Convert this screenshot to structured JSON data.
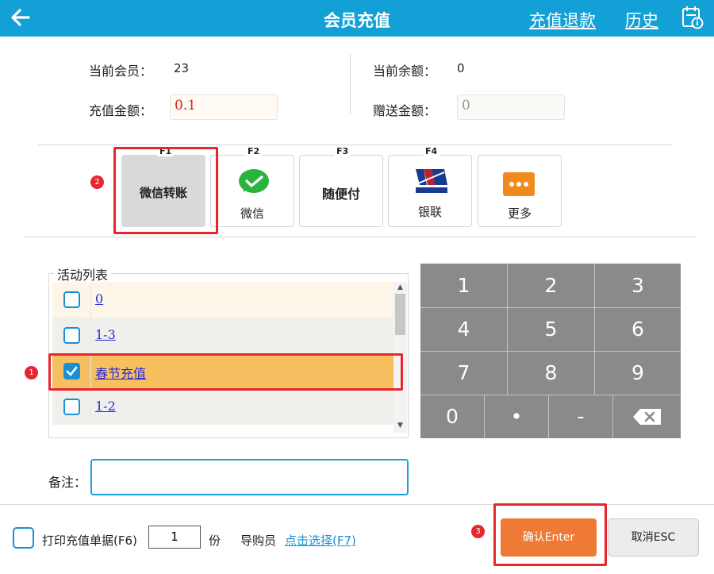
{
  "header": {
    "back_icon": "arrow-left-icon",
    "title": "会员充值",
    "refund_link": "充值退款",
    "history_link": "历史",
    "calendar_icon": "calendar-info-icon",
    "color": "#12a0d6"
  },
  "member": {
    "current_member_label": "当前会员：",
    "current_member_value": "23",
    "current_balance_label": "当前余额：",
    "current_balance_value": "0",
    "recharge_amount_label": "充值金额：",
    "recharge_amount_value": "0.1",
    "bonus_amount_label": "赠送金额：",
    "bonus_amount_value": "0"
  },
  "payment": {
    "methods": [
      {
        "key": "F1",
        "label": "微信转账",
        "icon": "none",
        "selected": true
      },
      {
        "key": "F2",
        "label": "微信",
        "icon": "wechat-pay-icon",
        "selected": false
      },
      {
        "key": "F3",
        "label": "随便付",
        "icon": "none",
        "selected": false
      },
      {
        "key": "F4",
        "label": "银联",
        "icon": "unionpay-icon",
        "selected": false
      },
      {
        "key": "",
        "label": "更多",
        "icon": "more-dots-icon",
        "selected": false
      }
    ]
  },
  "markers": {
    "m1": "1",
    "m2": "2",
    "m3": "3"
  },
  "activity": {
    "title": "活动列表",
    "rows": [
      {
        "label": "0",
        "checked": false
      },
      {
        "label": "1-3",
        "checked": false
      },
      {
        "label": "春节充值",
        "checked": true
      },
      {
        "label": "1-2",
        "checked": false
      }
    ],
    "scroll_up": "▲",
    "scroll_down": "▼"
  },
  "keypad": {
    "keys": [
      "1",
      "2",
      "3",
      "4",
      "5",
      "6",
      "7",
      "8",
      "9",
      "0",
      "•",
      "-"
    ],
    "backspace_icon": "backspace-icon",
    "color": "#8a8a8a"
  },
  "remark": {
    "label": "备注：",
    "value": ""
  },
  "footer": {
    "print_label": "打印充值单据(F6)",
    "copies_value": "1",
    "copies_unit": "份",
    "guide_label": "导购员",
    "guide_link": "点击选择(F7)",
    "confirm_label": "确认Enter",
    "cancel_label": "取消ESC",
    "confirm_color": "#ef7a35"
  }
}
